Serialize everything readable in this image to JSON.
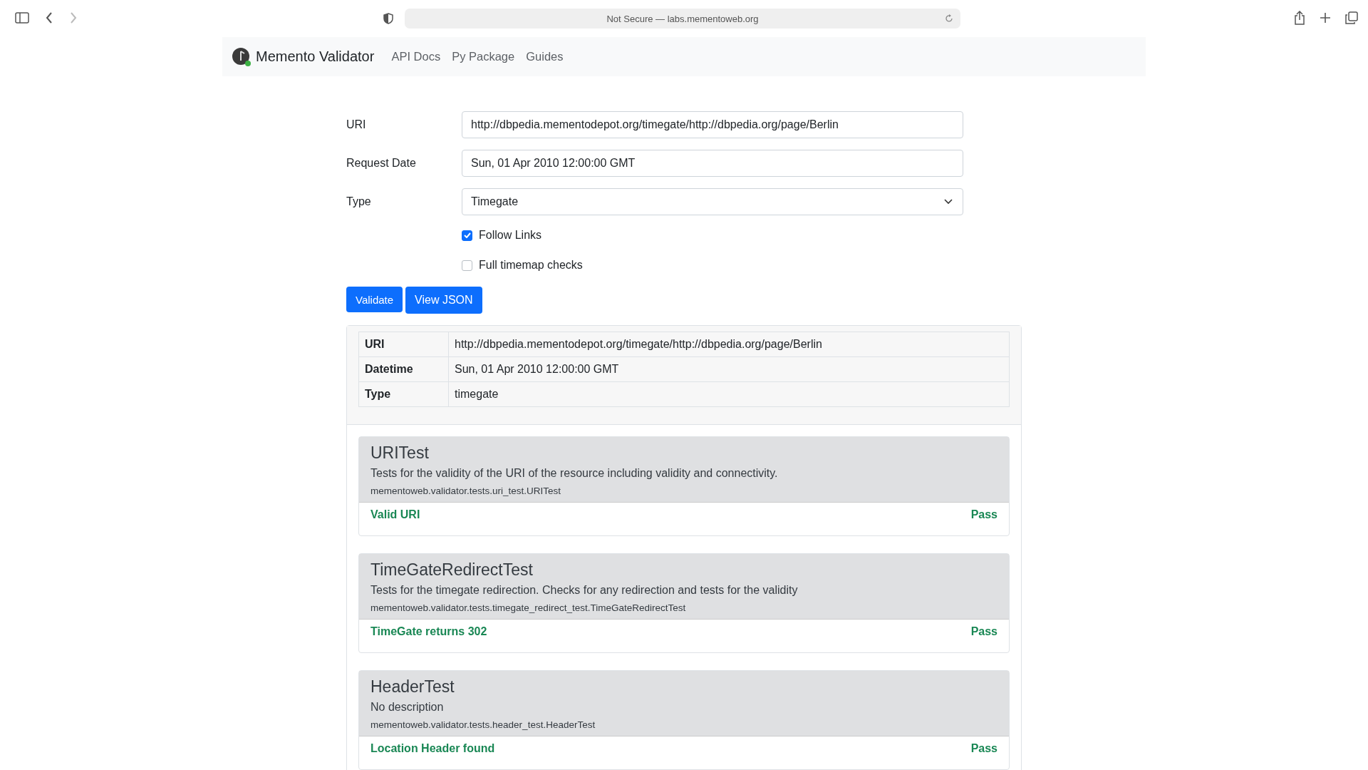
{
  "browser": {
    "address": "Not Secure — labs.mementoweb.org"
  },
  "navbar": {
    "brand": "Memento Validator",
    "links": [
      "API Docs",
      "Py Package",
      "Guides"
    ]
  },
  "form": {
    "fields": [
      {
        "kind": "text",
        "label": "URI",
        "value": "http://dbpedia.mementodepot.org/timegate/http://dbpedia.org/page/Berlin"
      },
      {
        "kind": "text",
        "label": "Request Date",
        "value": "Sun, 01 Apr 2010 12:00:00 GMT"
      },
      {
        "kind": "select",
        "label": "Type",
        "value": "Timegate"
      }
    ],
    "checkboxes": [
      {
        "label": "Follow Links",
        "checked": true
      },
      {
        "label": "Full timemap checks",
        "checked": false
      }
    ],
    "buttons": [
      "Validate",
      "View JSON"
    ]
  },
  "summary": [
    {
      "key": "URI",
      "value": "http://dbpedia.mementodepot.org/timegate/http://dbpedia.org/page/Berlin"
    },
    {
      "key": "Datetime",
      "value": "Sun, 01 Apr 2010 12:00:00 GMT"
    },
    {
      "key": "Type",
      "value": "timegate"
    }
  ],
  "tests": [
    {
      "name": "URITest",
      "description": "Tests for the validity of the URI of the resource including validity and connectivity.",
      "module": "mementoweb.validator.tests.uri_test.URITest",
      "results": [
        {
          "name": "Valid URI",
          "status": "Pass",
          "passed": true
        }
      ]
    },
    {
      "name": "TimeGateRedirectTest",
      "description": "Tests for the timegate redirection. Checks for any redirection and tests for the validity",
      "module": "mementoweb.validator.tests.timegate_redirect_test.TimeGateRedirectTest",
      "results": [
        {
          "name": "TimeGate returns 302",
          "status": "Pass",
          "passed": true
        }
      ]
    },
    {
      "name": "HeaderTest",
      "description": "No description",
      "module": "mementoweb.validator.tests.header_test.HeaderTest",
      "results": [
        {
          "name": "Location Header found",
          "status": "Pass",
          "passed": true
        }
      ]
    }
  ]
}
